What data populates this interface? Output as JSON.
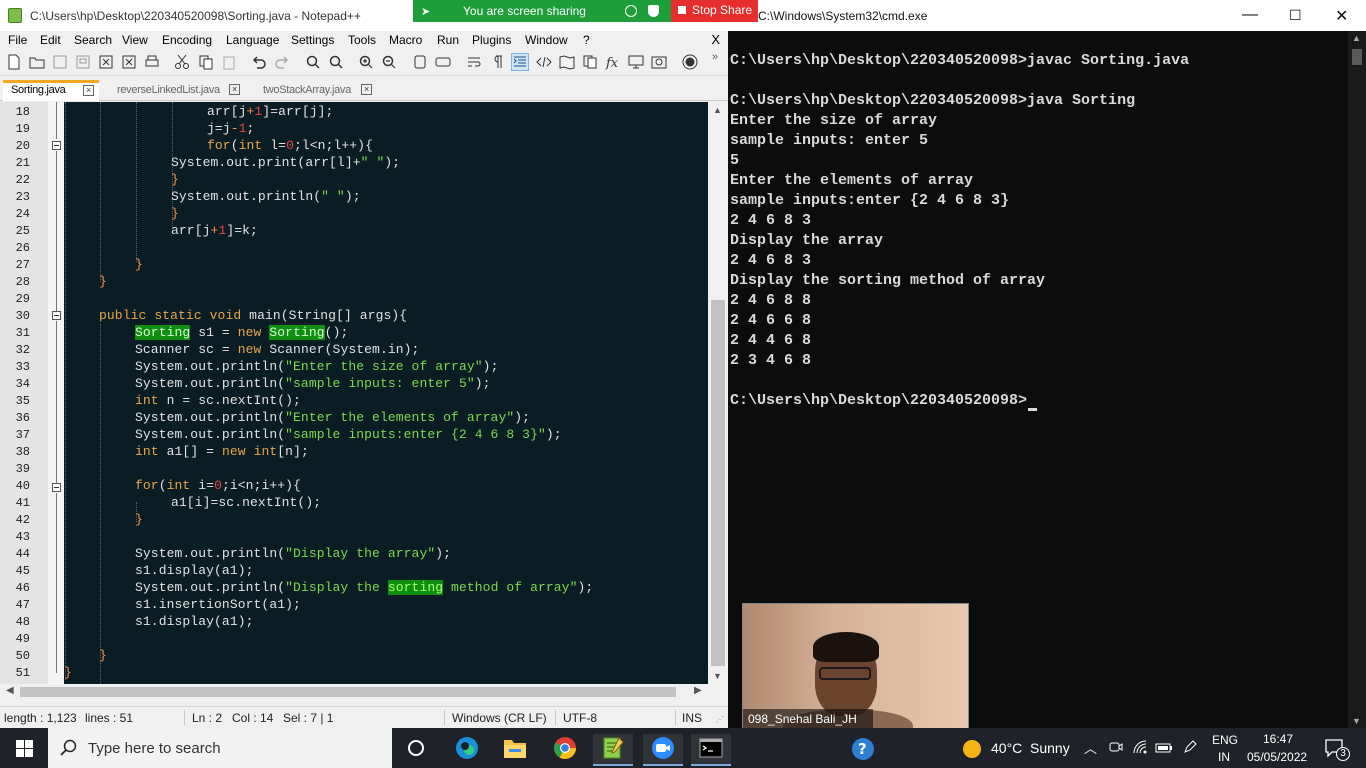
{
  "notepad": {
    "title": "C:\\Users\\hp\\Desktop\\220340520098\\Sorting.java - Notepad++",
    "menu": [
      "File",
      "Edit",
      "Search",
      "View",
      "Encoding",
      "Language",
      "Settings",
      "Tools",
      "Macro",
      "Run",
      "Plugins",
      "Window",
      "?"
    ],
    "menu_close": "X",
    "toolbar_icons": [
      "new-file-icon",
      "open-file-icon",
      "save-icon",
      "save-all-icon",
      "close-icon",
      "close-all-icon",
      "print-icon",
      "cut-icon",
      "copy-icon",
      "paste-icon",
      "undo-icon",
      "redo-icon",
      "find-icon",
      "replace-icon",
      "zoom-in-icon",
      "zoom-out-icon",
      "sync-vertical-icon",
      "sync-horizontal-icon",
      "word-wrap-icon",
      "show-all-chars-icon",
      "indent-guide-icon",
      "xml-icon",
      "doc-map-icon",
      "function-list-icon",
      "function-icon",
      "monitor-icon",
      "folder-workspace-icon",
      "record-macro-icon"
    ],
    "tabs": [
      {
        "label": "Sorting.java",
        "active": true
      },
      {
        "label": "reverseLinkedList.java",
        "active": false
      },
      {
        "label": "twoStackArray.java",
        "active": false
      }
    ],
    "line_numbers": [
      "18",
      "19",
      "20",
      "21",
      "22",
      "23",
      "24",
      "25",
      "26",
      "27",
      "28",
      "29",
      "30",
      "31",
      "32",
      "33",
      "34",
      "35",
      "36",
      "37",
      "38",
      "39",
      "40",
      "41",
      "42",
      "43",
      "44",
      "45",
      "46",
      "47",
      "48",
      "49",
      "50",
      "51"
    ],
    "code": {
      "l18": {
        "a": "arr[j",
        "b": "+",
        "c": "1",
        "d": "]=arr[j];"
      },
      "l19": {
        "a": "j=j",
        "b": "-",
        "c": "1",
        "d": ";"
      },
      "l20": {
        "a": "for",
        "b": "(",
        "c": "int",
        "d": " l=",
        "e": "0",
        "f": ";l<n;l++){"
      },
      "l21": {
        "a": "System.out.print(arr[l]+",
        "b": "\" \"",
        "c": ");"
      },
      "l22": {
        "a": "}"
      },
      "l23": {
        "a": "System.out.println(",
        "b": "\" \"",
        "c": ");"
      },
      "l24": {
        "a": "}"
      },
      "l25": {
        "a": "arr[j",
        "b": "+",
        "c": "1",
        "d": "]=k;"
      },
      "l27": {
        "a": "}"
      },
      "l28": {
        "a": "}"
      },
      "l30": {
        "a": "public",
        "b": " ",
        "c": "static",
        "d": " ",
        "e": "void",
        "f": " main(String[] args){"
      },
      "l31": {
        "a": "Sorting",
        "b": " s1 = ",
        "c": "new",
        "d": " ",
        "e": "Sorting",
        "f": "();"
      },
      "l32": {
        "a": "Scanner sc = ",
        "b": "new",
        "c": " Scanner(System.in);"
      },
      "l33": {
        "a": "System.out.println(",
        "b": "\"Enter the size of array\"",
        "c": ");"
      },
      "l34": {
        "a": "System.out.println(",
        "b": "\"sample inputs: enter 5\"",
        "c": ");"
      },
      "l35": {
        "a": "int",
        "b": " n = sc.nextInt();"
      },
      "l36": {
        "a": "System.out.println(",
        "b": "\"Enter the elements of array\"",
        "c": ");"
      },
      "l37": {
        "a": "System.out.println(",
        "b": "\"sample inputs:enter {2 4 6 8 3}\"",
        "c": ");"
      },
      "l38": {
        "a": "int",
        "b": " a1[] = ",
        "c": "new",
        "d": " ",
        "e": "int",
        "f": "[n];"
      },
      "l40": {
        "a": "for",
        "b": "(",
        "c": "int",
        "d": " i=",
        "e": "0",
        "f": ";i<n;i++){"
      },
      "l41": {
        "a": "a1[i]=sc.nextInt();"
      },
      "l42": {
        "a": "}"
      },
      "l44": {
        "a": "System.out.println(",
        "b": "\"Display the array\"",
        "c": ");"
      },
      "l45": {
        "a": "s1.display(a1);"
      },
      "l46": {
        "a": "System.out.println(",
        "b": "\"Display the ",
        "c": "sorting",
        "d": " method of array\"",
        "e": ");"
      },
      "l47": {
        "a": "s1.insertionSort(a1);"
      },
      "l48": {
        "a": "s1.display(a1);"
      },
      "l50": {
        "a": "}"
      },
      "l51": {
        "a": "}"
      }
    },
    "status": {
      "length": "length : 1,123",
      "lines": "lines : 51",
      "ln": "Ln : 2",
      "col": "Col : 14",
      "sel": "Sel : 7 | 1",
      "eol": "Windows (CR LF)",
      "encoding": "UTF-8",
      "mode": "INS"
    }
  },
  "share": {
    "sharing_label": "You are screen sharing",
    "stop_label": "Stop Share"
  },
  "cmd": {
    "title": "C:\\Windows\\System32\\cmd.exe",
    "lines": [
      "C:\\Users\\hp\\Desktop\\220340520098>javac Sorting.java",
      "",
      "C:\\Users\\hp\\Desktop\\220340520098>java Sorting",
      "Enter the size of array",
      "sample inputs: enter 5",
      "5",
      "Enter the elements of array",
      "sample inputs:enter {2 4 6 8 3}",
      "2 4 6 8 3",
      "Display the array",
      "2 4 6 8 3",
      "Display the sorting method of array",
      "2 4 6 8 8",
      "2 4 6 6 8",
      "2 4 4 6 8",
      "2 3 4 6 8",
      "",
      "C:\\Users\\hp\\Desktop\\220340520098>"
    ]
  },
  "webcam": {
    "participant_name": "098_Snehal Bali_JH"
  },
  "taskbar": {
    "search_placeholder": "Type here to search",
    "apps": [
      "task-view-icon",
      "edge-icon",
      "file-explorer-icon",
      "chrome-icon",
      "notepadpp-icon",
      "zoom-icon",
      "cmd-icon"
    ],
    "weather_temp": "40°C",
    "weather_text": "Sunny",
    "lang_top": "ENG",
    "lang_bottom": "IN",
    "time": "16:47",
    "date": "05/05/2022",
    "notification_count": "3"
  },
  "colors": {
    "editor_bg": "#0a1c24",
    "keyword": "#e8a54a",
    "string": "#7fd94d",
    "number": "#f04444",
    "match_highlight": "#0f8f0f",
    "share_green": "#1e9e3a",
    "stop_red": "#e62e2e",
    "taskbar": "#1f2228"
  }
}
